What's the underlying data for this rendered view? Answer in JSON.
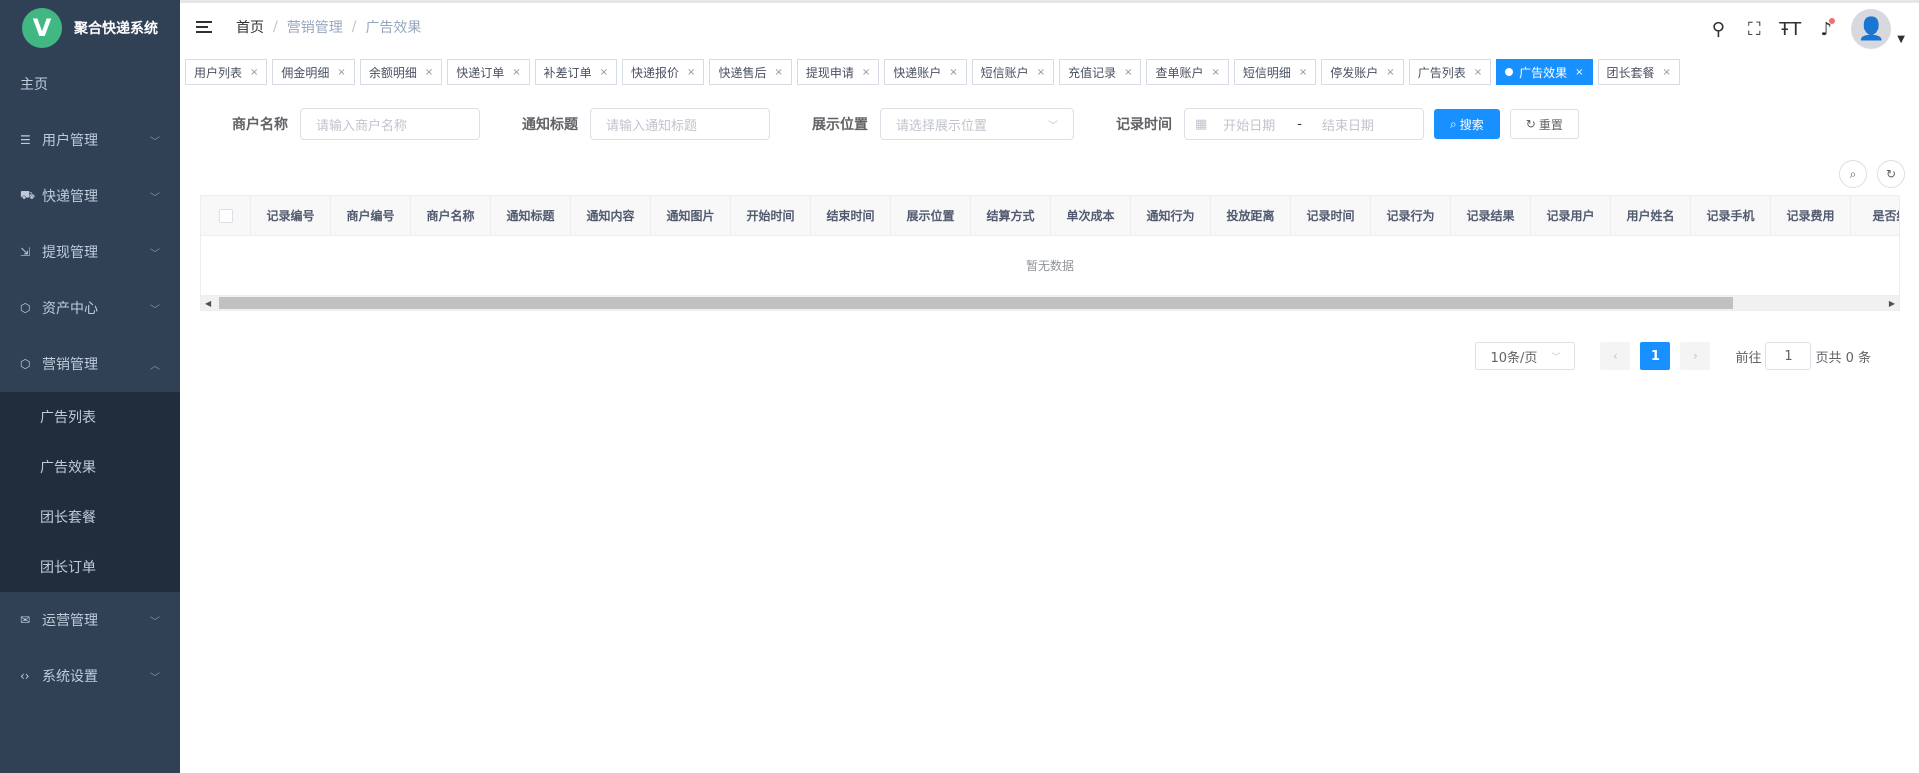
{
  "app": {
    "logo_letter": "V",
    "title": "聚合快递系统"
  },
  "sidebar": {
    "home": "主页",
    "items": [
      {
        "label": "用户管理",
        "icon": "list-icon"
      },
      {
        "label": "快递管理",
        "icon": "truck-icon"
      },
      {
        "label": "提现管理",
        "icon": "withdraw-icon"
      },
      {
        "label": "资产中心",
        "icon": "box-icon"
      },
      {
        "label": "营销管理",
        "icon": "box-icon"
      }
    ],
    "sub_items": [
      "广告列表",
      "广告效果",
      "团长套餐",
      "团长订单"
    ],
    "bottom_items": [
      {
        "label": "运营管理",
        "icon": "mail-icon"
      },
      {
        "label": "系统设置",
        "icon": "code-icon"
      }
    ]
  },
  "breadcrumb": [
    "首页",
    "营销管理",
    "广告效果"
  ],
  "tags": [
    "用户列表",
    "佣金明细",
    "余额明细",
    "快递订单",
    "补差订单",
    "快递报价",
    "快递售后",
    "提现申请",
    "快递账户",
    "短信账户",
    "充值记录",
    "查单账户",
    "短信明细",
    "停发账户",
    "广告列表",
    "广告效果",
    "团长套餐"
  ],
  "active_tag": "广告效果",
  "filters": {
    "merchant_label": "商户名称",
    "merchant_placeholder": "请输入商户名称",
    "title_label": "通知标题",
    "title_placeholder": "请输入通知标题",
    "position_label": "展示位置",
    "position_placeholder": "请选择展示位置",
    "time_label": "记录时间",
    "start_placeholder": "开始日期",
    "range_sep": "-",
    "end_placeholder": "结束日期",
    "search_label": "搜索",
    "reset_label": "重置"
  },
  "table": {
    "columns": [
      "记录编号",
      "商户编号",
      "商户名称",
      "通知标题",
      "通知内容",
      "通知图片",
      "开始时间",
      "结束时间",
      "展示位置",
      "结算方式",
      "单次成本",
      "通知行为",
      "投放距离",
      "记录时间",
      "记录行为",
      "记录结果",
      "记录用户",
      "用户姓名",
      "记录手机",
      "记录费用",
      "是否结"
    ],
    "empty_text": "暂无数据"
  },
  "pagination": {
    "page_size": "10条/页",
    "current_page": "1",
    "goto_label": "前往",
    "goto_value": "1",
    "total_text": "页共 0 条"
  }
}
